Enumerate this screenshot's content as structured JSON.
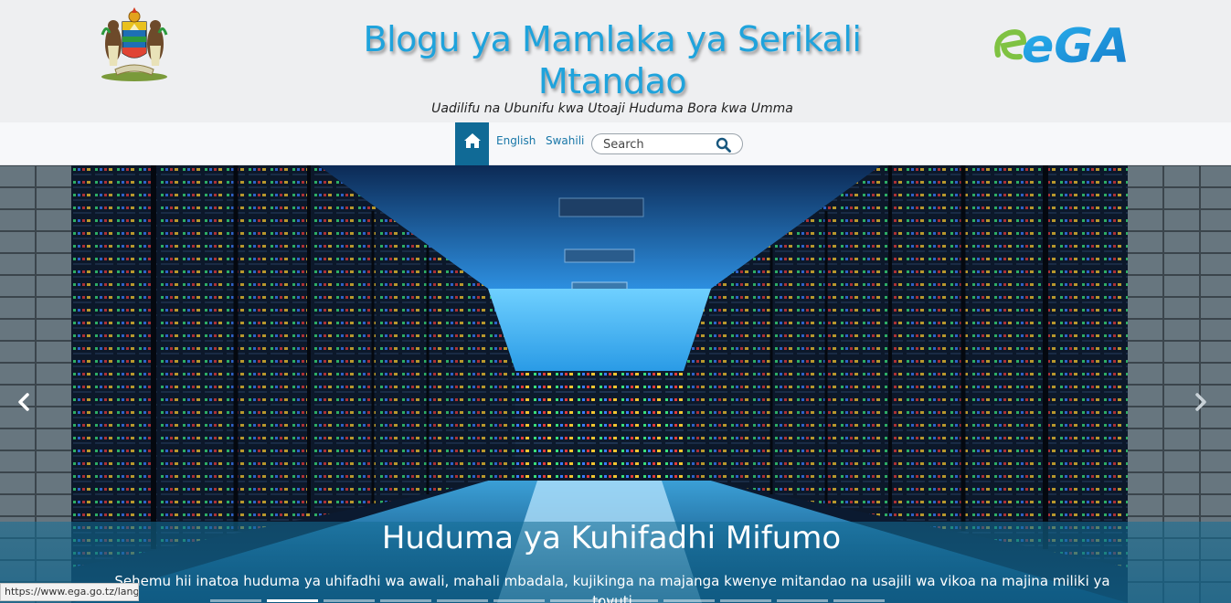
{
  "header": {
    "title": "Blogu ya Mamlaka ya Serikali Mtandao",
    "tagline": "Uadilifu na Ubunifu kwa Utoaji Huduma Bora kwa Umma",
    "right_logo_text": "eGA"
  },
  "nav": {
    "home_icon": "home-icon",
    "english": "English",
    "swahili": "Swahili",
    "search_placeholder": "Search"
  },
  "slider": {
    "slide_title": "Huduma ya Kuhifadhi Mifumo",
    "slide_text": "Sehemu hii inatoa huduma ya uhifadhi wa awali, mahali mbadala, kujikinga na majanga kwenye mitandao na usajili wa vikoa na majina miliki ya tovuti",
    "prev_icon": "chevron-left-icon",
    "next_icon": "chevron-right-icon",
    "indicator_count": 12,
    "active_indicator": 1
  },
  "status_bar": {
    "url": "https://www.ega.go.tz/langu"
  },
  "colors": {
    "title_blue": "#1fa3dc",
    "nav_blue": "#106a96",
    "link_blue": "#1877a8"
  }
}
